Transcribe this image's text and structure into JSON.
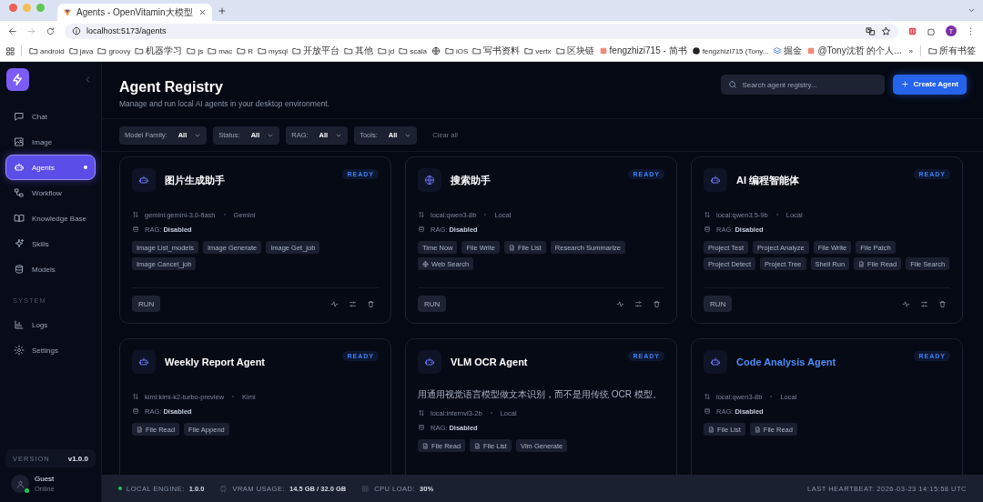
{
  "browser": {
    "tab_title": "Agents - OpenVitamin大模型",
    "url": "localhost:5173/agents",
    "profile_initial": "T",
    "bookmarks": [
      {
        "label": "android",
        "kind": "folder"
      },
      {
        "label": "java",
        "kind": "folder"
      },
      {
        "label": "groovy",
        "kind": "folder"
      },
      {
        "label": "机器学习",
        "kind": "folder"
      },
      {
        "label": "js",
        "kind": "folder"
      },
      {
        "label": "mac",
        "kind": "folder"
      },
      {
        "label": "R",
        "kind": "folder"
      },
      {
        "label": "mysql",
        "kind": "folder"
      },
      {
        "label": "开放平台",
        "kind": "folder"
      },
      {
        "label": "其他",
        "kind": "folder"
      },
      {
        "label": "jd",
        "kind": "folder"
      },
      {
        "label": "scala",
        "kind": "folder"
      },
      {
        "kind": "globe"
      },
      {
        "label": "iOS",
        "kind": "folder"
      },
      {
        "label": "写书资料",
        "kind": "folder"
      },
      {
        "label": "vertx",
        "kind": "folder"
      },
      {
        "label": "区块链",
        "kind": "folder"
      },
      {
        "label": "fengzhizi715 - 简书",
        "kind": "site"
      },
      {
        "label": "fengzhizi715 (Tony...",
        "kind": "github"
      },
      {
        "label": "掘金",
        "kind": "layers"
      },
      {
        "label": "@Tony沈哲 的个人...",
        "kind": "site"
      }
    ],
    "more": "»",
    "all_bookmarks": "所有书签"
  },
  "sidebar": {
    "items": [
      {
        "label": "Chat",
        "selected": false
      },
      {
        "label": "Image",
        "selected": false
      },
      {
        "label": "Agents",
        "selected": true
      },
      {
        "label": "Workflow",
        "selected": false
      },
      {
        "label": "Knowledge Base",
        "selected": false
      },
      {
        "label": "Skills",
        "selected": false
      },
      {
        "label": "Models",
        "selected": false
      }
    ],
    "section": "SYSTEM",
    "system_items": [
      {
        "label": "Logs",
        "selected": false
      },
      {
        "label": "Settings",
        "selected": false
      }
    ],
    "version_label": "VERSION",
    "version": "v1.0.0",
    "user": {
      "name": "Guest",
      "status": "Online",
      "online": true
    }
  },
  "header": {
    "title": "Agent Registry",
    "subtitle": "Manage and run local AI agents in your desktop environment.",
    "search": {
      "placeholder": "Search agent registry..."
    },
    "create_button": "Create Agent"
  },
  "filters": [
    {
      "label": "Model Family:",
      "value": "All"
    },
    {
      "label": "Status:",
      "value": "All"
    },
    {
      "label": "RAG:",
      "value": "All"
    },
    {
      "label": "Tools:",
      "value": "All"
    }
  ],
  "clear_filters": "Clear all",
  "agents": [
    {
      "name": "图片生成助手",
      "kind": "robot",
      "status": "READY",
      "highlighted": false,
      "model": "gemini:gemini-3.0-flash",
      "provider": "Gemini",
      "rag": "RAG: **Disabled**",
      "tools": [
        {
          "label": "Image List_models",
          "kind": "plain"
        },
        {
          "label": "Image Generate",
          "kind": "plain"
        },
        {
          "label": "Image Get_job",
          "kind": "plain"
        },
        {
          "label": "Image Cancel_job",
          "kind": "plain"
        }
      ],
      "run": "RUN"
    },
    {
      "name": "搜索助手",
      "kind": "globe",
      "status": "READY",
      "highlighted": false,
      "model": "local:qwen3-8b",
      "provider": "Local",
      "rag": "RAG: **Disabled**",
      "tools": [
        {
          "label": "Time Now",
          "kind": "plain"
        },
        {
          "label": "File Write",
          "kind": "plain"
        },
        {
          "label": "File List",
          "kind": "file"
        },
        {
          "label": "Research Summarize",
          "kind": "plain"
        },
        {
          "label": "Web Search",
          "kind": "globe"
        }
      ],
      "run": "RUN"
    },
    {
      "name": "AI 编程智能体",
      "kind": "robot",
      "status": "READY",
      "highlighted": false,
      "model": "local:qwen3.5-9b",
      "provider": "Local",
      "rag": "RAG: **Disabled**",
      "tools": [
        {
          "label": "Project Test",
          "kind": "plain"
        },
        {
          "label": "Project Analyze",
          "kind": "plain"
        },
        {
          "label": "File Write",
          "kind": "plain"
        },
        {
          "label": "File Patch",
          "kind": "plain"
        },
        {
          "label": "Project Detect",
          "kind": "plain"
        },
        {
          "label": "Project Tree",
          "kind": "plain"
        },
        {
          "label": "Shell Run",
          "kind": "plain"
        },
        {
          "label": "File Read",
          "kind": "file"
        },
        {
          "label": "File Search",
          "kind": "plain"
        }
      ],
      "run": "RUN"
    },
    {
      "name": "Weekly Report Agent",
      "kind": "robot",
      "status": "READY",
      "highlighted": false,
      "model": "kimi:kimi-k2-turbo-preview",
      "provider": "Kimi",
      "rag": "RAG: **Disabled**",
      "tools": [
        {
          "label": "File Read",
          "kind": "file"
        },
        {
          "label": "File Append",
          "kind": "plain"
        }
      ]
    },
    {
      "name": "VLM OCR Agent",
      "kind": "robot",
      "status": "READY",
      "highlighted": false,
      "description": "用通用视觉语言模型做文本识别，而不是用传统 OCR 模型。",
      "model": "local:internvl3-2b",
      "provider": "Local",
      "rag": "RAG: **Disabled**",
      "tools": [
        {
          "label": "File Read",
          "kind": "file"
        },
        {
          "label": "File List",
          "kind": "file"
        },
        {
          "label": "Vlm Generate",
          "kind": "plain"
        }
      ]
    },
    {
      "name": "Code Analysis Agent",
      "kind": "robot",
      "status": "READY",
      "highlighted": true,
      "model": "local:qwen3-8b",
      "provider": "Local",
      "rag": "RAG: **Disabled**",
      "tools": [
        {
          "label": "File List",
          "kind": "file"
        },
        {
          "label": "File Read",
          "kind": "file"
        }
      ]
    }
  ],
  "status_bar": {
    "engine_label": "LOCAL ENGINE:",
    "engine_value": "1.0.0",
    "engine_online": true,
    "vram_label": "VRAM USAGE:",
    "vram_value": "14.5 GB / 32.0 GB",
    "cpu_label": "CPU LOAD:",
    "cpu_value": "30%",
    "heartbeat": "LAST HEARTBEAT: 2026-03-23 14:15:58 UTC"
  }
}
